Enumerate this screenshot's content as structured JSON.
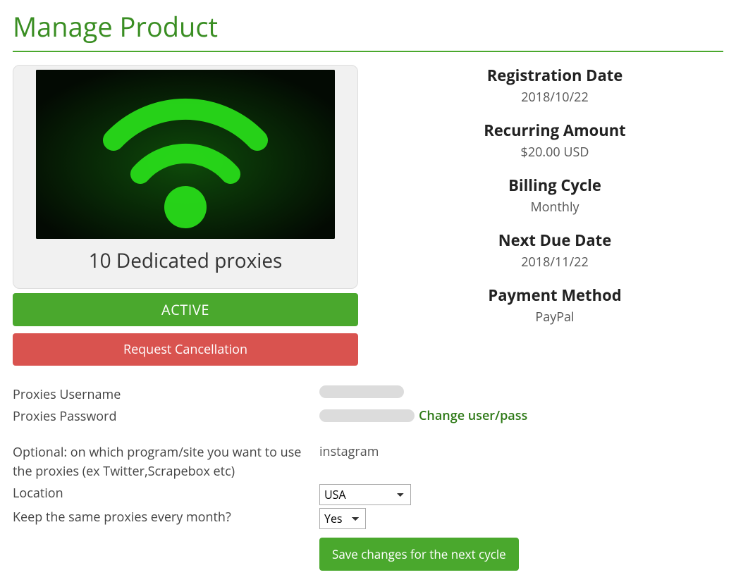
{
  "page": {
    "title": "Manage Product"
  },
  "product": {
    "name": "10 Dedicated proxies",
    "status": "ACTIVE",
    "cancel_label": "Request Cancellation"
  },
  "details": {
    "registration_date": {
      "label": "Registration Date",
      "value": "2018/10/22"
    },
    "recurring_amount": {
      "label": "Recurring Amount",
      "value": "$20.00 USD"
    },
    "billing_cycle": {
      "label": "Billing Cycle",
      "value": "Monthly"
    },
    "next_due_date": {
      "label": "Next Due Date",
      "value": "2018/11/22"
    },
    "payment_method": {
      "label": "Payment Method",
      "value": "PayPal"
    }
  },
  "form": {
    "username_label": "Proxies Username",
    "password_label": "Proxies Password",
    "change_link": "Change user/pass",
    "program_label": "Optional: on which program/site you want to use the proxies (ex Twitter,Scrapebox etc)",
    "program_value": "instagram",
    "location_label": "Location",
    "location_value": "USA",
    "keep_label": "Keep the same proxies every month?",
    "keep_value": "Yes",
    "save_label": "Save changes for the next cycle"
  }
}
